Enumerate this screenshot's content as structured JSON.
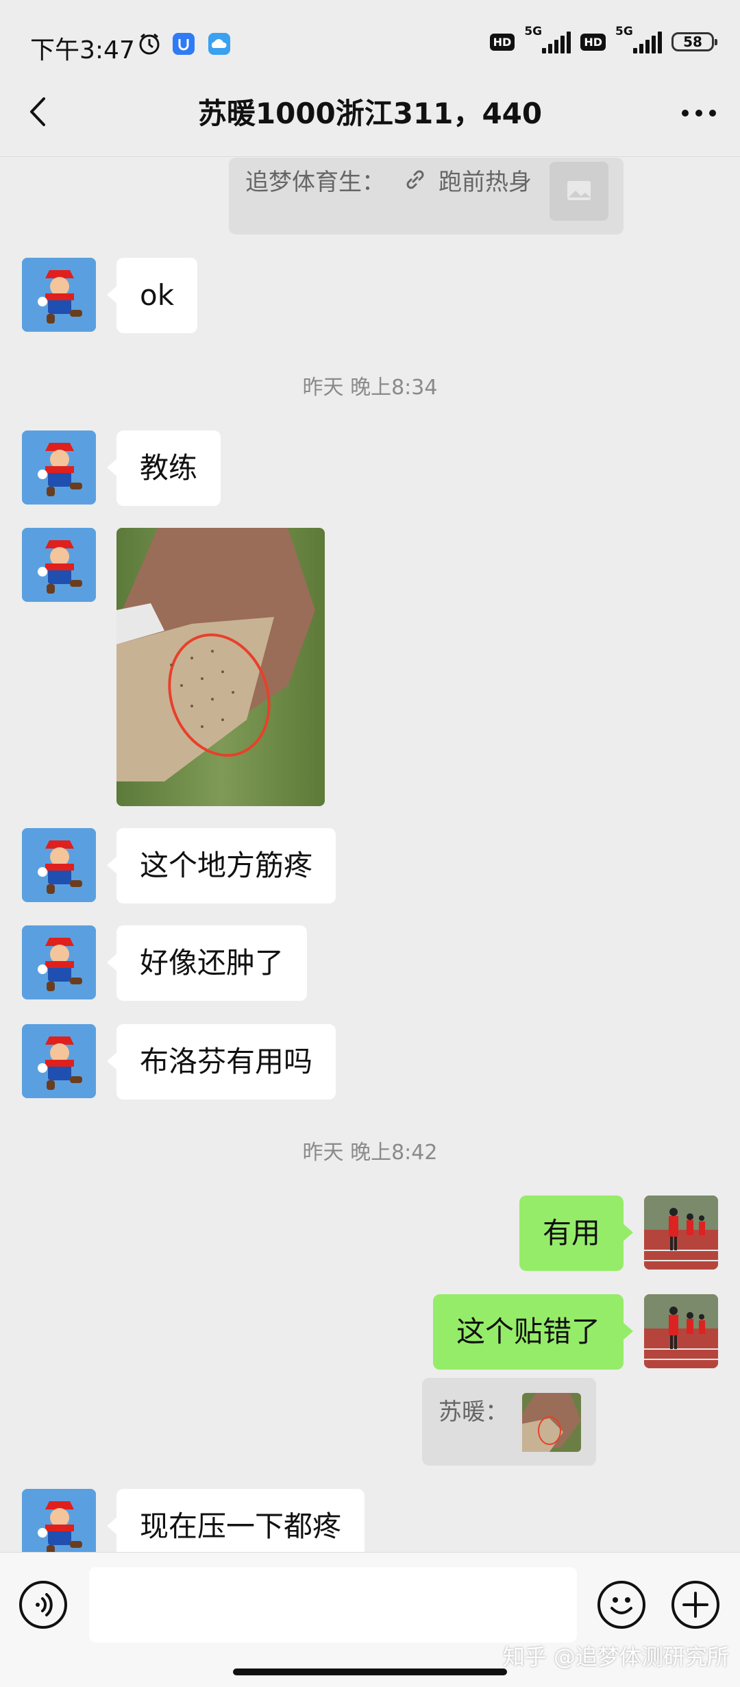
{
  "status_bar": {
    "time": "下午3:47",
    "network1": "5G",
    "network2": "5G",
    "hd": "HD",
    "battery": "58"
  },
  "header": {
    "title": "苏暖1000浙江311，440"
  },
  "messages": {
    "top_quote": {
      "sender": "追梦体育生：",
      "text": "跑前热身"
    },
    "ok": "ok",
    "ts1": "昨天 晚上8:34",
    "m_coach": "教练",
    "m_spot": "这个地方筋疼",
    "m_swollen": "好像还肿了",
    "m_ibuprofen": "布洛芬有用吗",
    "ts2": "昨天 晚上8:42",
    "r_useful": "有用",
    "r_wrong": "这个贴错了",
    "quote_reply": {
      "sender": "苏暖："
    },
    "m_press": "现在压一下都疼"
  },
  "watermark": "知乎 @追梦体测研究所",
  "colors": {
    "background": "#ededed",
    "bubble_self": "#95ec69",
    "bubble_other": "#ffffff"
  }
}
